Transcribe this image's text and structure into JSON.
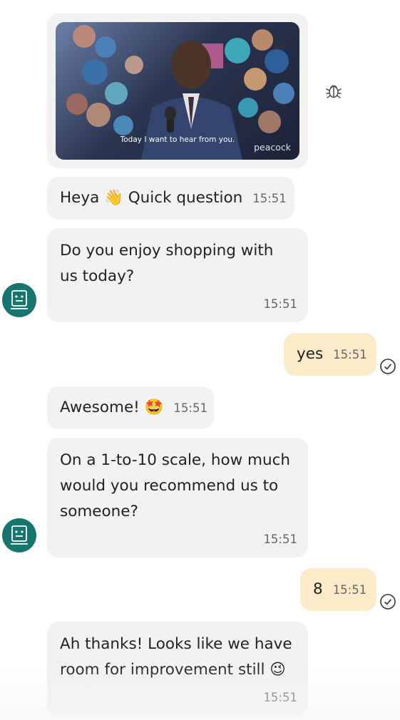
{
  "gif_message": {
    "caption": "Today I want to hear from you.",
    "brand": "peacock",
    "report_icon": "bug-icon"
  },
  "messages": [
    {
      "sender": "bot",
      "text": "Heya 👋 Quick question",
      "time": "15:51"
    },
    {
      "sender": "bot",
      "line1": "Do you enjoy shopping with",
      "line2": "us today?",
      "time": "15:51"
    },
    {
      "sender": "user",
      "text": "yes",
      "time": "15:51"
    },
    {
      "sender": "bot",
      "text": "Awesome! 🤩",
      "time": "15:51"
    },
    {
      "sender": "bot",
      "line1": "On a 1-to-10 scale, how much",
      "line2": "would you recommend us to",
      "line3": "someone?",
      "time": "15:51"
    },
    {
      "sender": "user",
      "text": "8",
      "time": "15:51"
    },
    {
      "sender": "bot",
      "line1": "Ah thanks! Looks like we have",
      "line2": "room for improvement still 😉",
      "time": "15:51"
    }
  ],
  "icons": {
    "avatar": "bot-avatar-icon",
    "status": "sent-check-icon"
  },
  "colors": {
    "bot_bubble": "#f2f2f2",
    "user_bubble": "#fbebc8",
    "avatar": "#16756f"
  }
}
